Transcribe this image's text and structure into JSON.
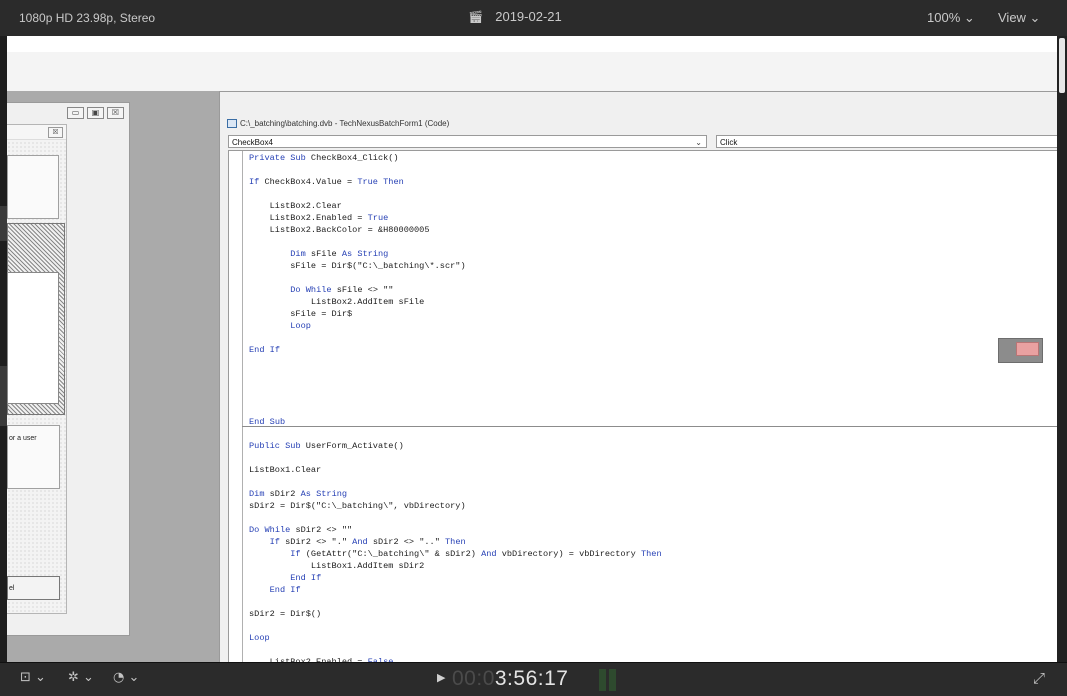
{
  "topbar": {
    "format": "1080p HD 23.98p, Stereo",
    "date": "2019-02-21",
    "date_icon": "clapperboard-icon",
    "zoom": "100% ⌄",
    "view": "View ⌄"
  },
  "form_window": {
    "buttons": [
      "▭",
      "▣",
      "☒"
    ],
    "close": "☒",
    "label_fragment": "or a user",
    "button_fragment": "el"
  },
  "code_window": {
    "title": "C:\\_batching\\batching.dvb - TechNexusBatchForm1 (Code)",
    "object_dropdown": "CheckBox4",
    "procedure_dropdown": "Click",
    "lines": [
      "Private Sub CheckBox4_Click()",
      "",
      "If CheckBox4.Value = True Then",
      "",
      "    ListBox2.Clear",
      "    ListBox2.Enabled = True",
      "    ListBox2.BackColor = &H80000005",
      "",
      "        Dim sFile As String",
      "        sFile = Dir$(\"C:\\_batching\\*.scr\")",
      "",
      "        Do While sFile <> \"\"",
      "            ListBox2.AddItem sFile",
      "        sFile = Dir$",
      "        Loop",
      "",
      "End If",
      "",
      "",
      "",
      "",
      "",
      "End Sub",
      "",
      "Public Sub UserForm_Activate()",
      "",
      "ListBox1.Clear",
      "",
      "Dim sDir2 As String",
      "sDir2 = Dir$(\"C:\\_batching\\\", vbDirectory)",
      "",
      "Do While sDir2 <> \"\"",
      "    If sDir2 <> \".\" And sDir2 <> \"..\" Then",
      "        If (GetAttr(\"C:\\_batching\\\" & sDir2) And vbDirectory) = vbDirectory Then",
      "            ListBox1.AddItem sDir2",
      "        End If",
      "    End If",
      "",
      "sDir2 = Dir$()",
      "",
      "Loop",
      "",
      "    ListBox2.Enabled = False"
    ]
  },
  "bottombar": {
    "icons": [
      "layout-icon",
      "transform-icon",
      "speed-icon"
    ],
    "glyphs": [
      "⊡ ⌄",
      "✲ ⌄",
      "◔ ⌄"
    ],
    "play": "▶",
    "timecode_dim": "00:0",
    "timecode_bright": "3:56:17",
    "fullscreen": "⤢"
  }
}
